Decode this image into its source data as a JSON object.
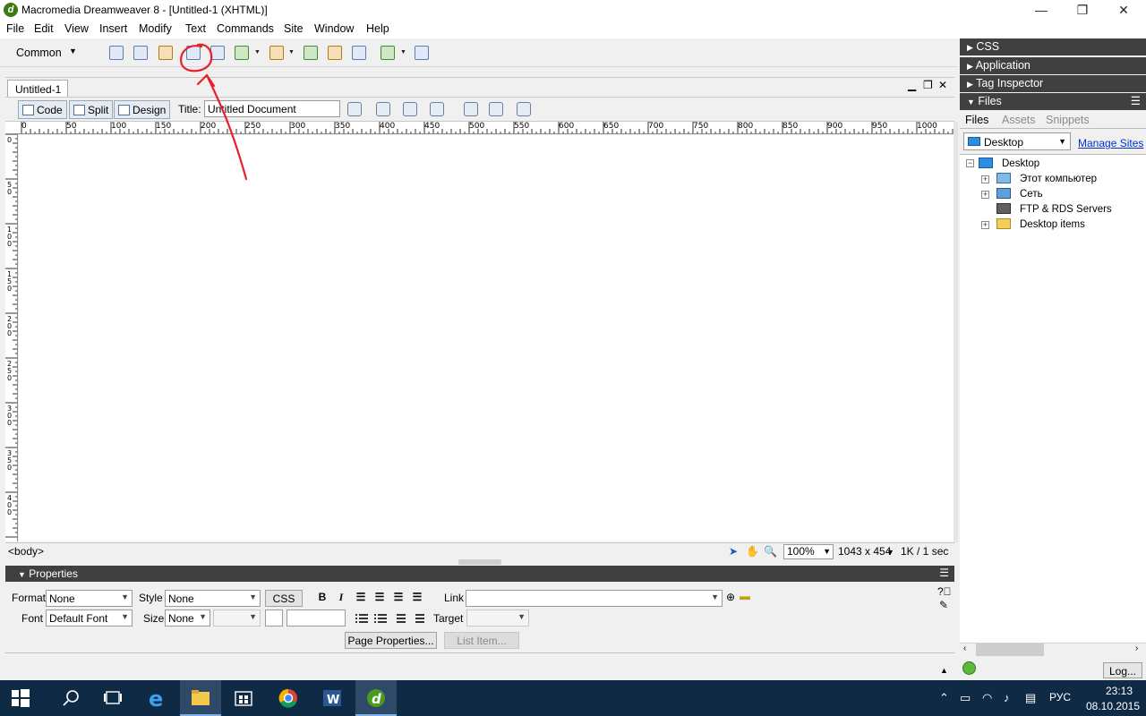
{
  "window": {
    "title": "Macromedia Dreamweaver 8 - [Untitled-1 (XHTML)]",
    "logo_letter": "d"
  },
  "menu": [
    "File",
    "Edit",
    "View",
    "Insert",
    "Modify",
    "Text",
    "Commands",
    "Site",
    "Window",
    "Help"
  ],
  "insert_bar": {
    "category": "Common",
    "icons": [
      "hyperlink-icon",
      "email-link-icon",
      "named-anchor-icon",
      "table-icon",
      "layer-icon",
      "image-icon",
      "media-icon",
      "date-icon",
      "server-side-include-icon",
      "comment-icon",
      "templates-icon",
      "tag-chooser-icon"
    ]
  },
  "document": {
    "tab_label": "Untitled-1",
    "views": [
      "Code",
      "Split",
      "Design"
    ],
    "title_label": "Title:",
    "title_value": "Untitled Document",
    "status_tag": "<body>",
    "zoom": "100%",
    "window_size": "1043 x 454",
    "download_stat": "1K / 1 sec"
  },
  "rulers": {
    "horizontal": [
      "0",
      "50",
      "100",
      "150",
      "200",
      "250",
      "300",
      "350",
      "400",
      "450",
      "500",
      "550",
      "600",
      "650",
      "700",
      "750",
      "800",
      "850",
      "900",
      "950",
      "1000"
    ],
    "vertical": [
      "0",
      "50",
      "100",
      "150",
      "200",
      "250",
      "300",
      "350",
      "400"
    ]
  },
  "properties": {
    "header": "Properties",
    "format_label": "Format",
    "format_value": "None",
    "style_label": "Style",
    "style_value": "None",
    "css_button": "CSS",
    "link_label": "Link",
    "link_value": "",
    "font_label": "Font",
    "font_value": "Default Font",
    "size_label": "Size",
    "size_value": "None",
    "target_label": "Target",
    "page_properties_button": "Page Properties...",
    "list_item_button": "List Item...",
    "bold_glyph": "B",
    "italic_glyph": "I"
  },
  "panels": {
    "groups": [
      "CSS",
      "Application",
      "Tag Inspector",
      "Files"
    ],
    "files_tabs": [
      "Files",
      "Assets",
      "Snippets"
    ],
    "site_value": "Desktop",
    "manage_sites": "Manage Sites",
    "tree": [
      {
        "label": "Desktop",
        "level": 0,
        "expander": "−"
      },
      {
        "label": "Этот компьютер",
        "level": 1,
        "expander": "+"
      },
      {
        "label": "Сеть",
        "level": 1,
        "expander": "+"
      },
      {
        "label": "FTP & RDS Servers",
        "level": 1,
        "expander": ""
      },
      {
        "label": "Desktop items",
        "level": 1,
        "expander": "+"
      }
    ],
    "log_button": "Log..."
  },
  "taskbar": {
    "language": "РУС",
    "time": "23:13",
    "date": "08.10.2015"
  },
  "colors": {
    "panel_header": "#404040",
    "taskbar": "#0f2a45",
    "annotation": "#e8202a",
    "link": "#0033cc"
  }
}
